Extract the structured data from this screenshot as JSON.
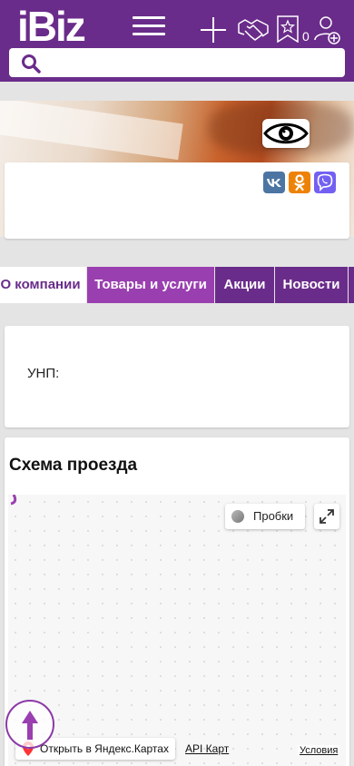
{
  "header": {
    "logo": "iBiz",
    "menu_icon": "hamburger-icon",
    "add_icon": "plus-icon",
    "partners_icon": "handshake-icon",
    "favorites_icon": "star-bookmark-icon",
    "favorites_count": "0",
    "user_add_icon": "user-add-icon",
    "search_icon": "search-icon",
    "search_placeholder": "",
    "brand_color": "#6a2c8a"
  },
  "banner": {
    "eye_icon": "eye-icon"
  },
  "social": [
    {
      "name": "vk",
      "glyph": "VK",
      "color": "#4c75a3"
    },
    {
      "name": "odnoklassniki",
      "glyph": "ok-icon",
      "color": "#ee8208"
    },
    {
      "name": "viber",
      "glyph": "viber-icon",
      "color": "#7360f2"
    }
  ],
  "tabs": [
    {
      "label": "О компании",
      "active": true
    },
    {
      "label": "Товары и услуги",
      "active": false
    },
    {
      "label": "Акции",
      "active": false
    },
    {
      "label": "Новости",
      "active": false
    }
  ],
  "company": {
    "unp_label": "УНП:"
  },
  "map": {
    "title": "Схема проезда",
    "traffic_label": "Пробки",
    "open_label": "Открыть в Яндекс.Картах",
    "api_label": "API Карт",
    "terms_label": "Условия"
  },
  "scroll_top_icon": "arrow-up-icon"
}
